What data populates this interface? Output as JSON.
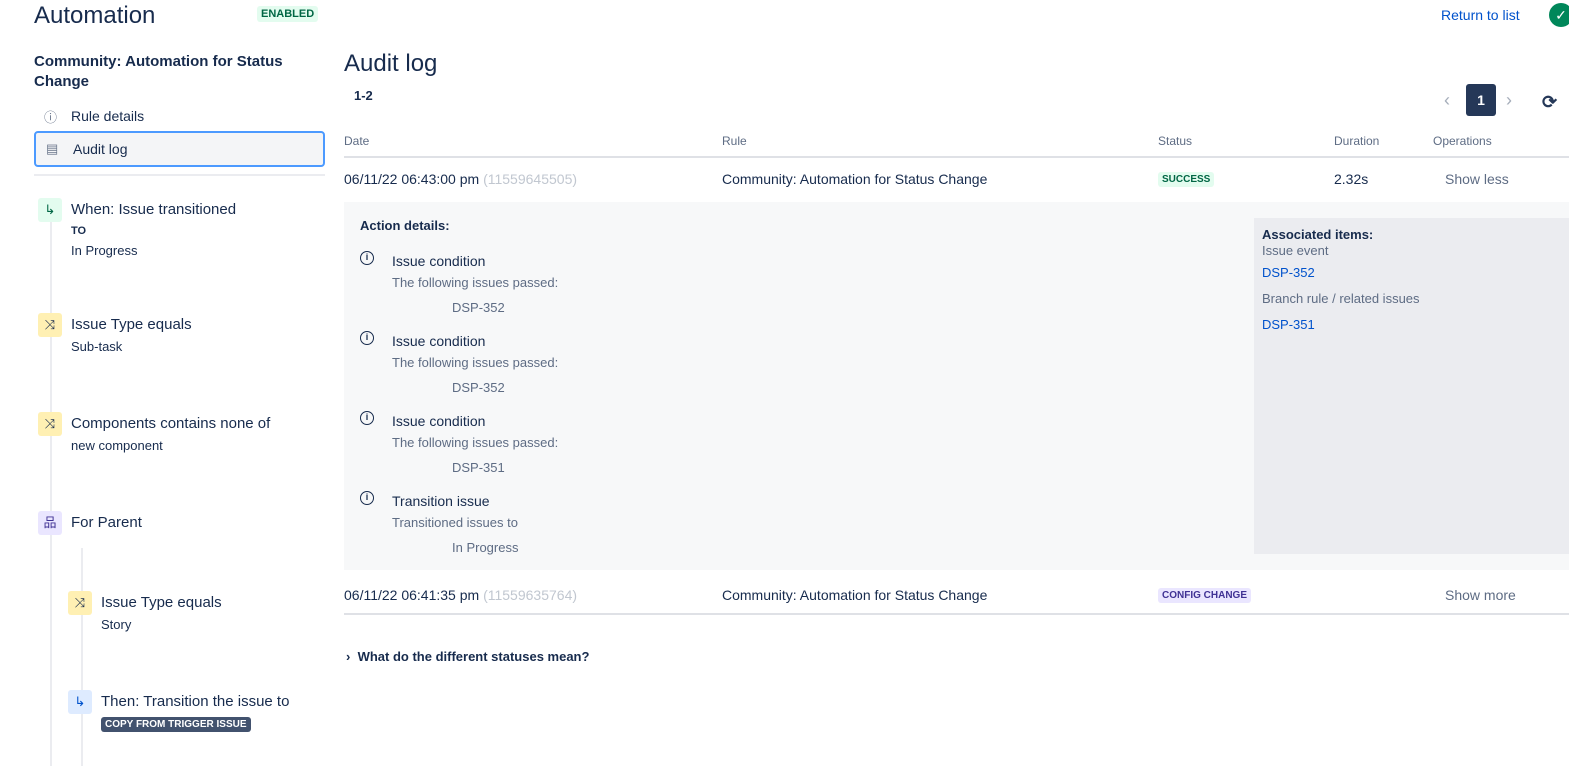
{
  "header": {
    "title": "Automation",
    "status": "ENABLED",
    "return_link": "Return to list"
  },
  "sidebar": {
    "rule_name": "Community: Automation for Status Change",
    "nav": [
      {
        "label": "Rule details",
        "icon": "info-icon"
      },
      {
        "label": "Audit log",
        "icon": "document-icon"
      }
    ],
    "steps": [
      {
        "title": "When: Issue transitioned",
        "sub1": "TO",
        "sub2": "In Progress",
        "icon": "transition-icon"
      },
      {
        "title": "Issue Type equals",
        "sub1": "Sub-task",
        "icon": "shuffle-icon"
      },
      {
        "title": "Components contains none of",
        "sub1": "new component",
        "icon": "shuffle-icon"
      },
      {
        "title": "For Parent",
        "icon": "hierarchy-icon"
      },
      {
        "title": "Issue Type equals",
        "sub1": "Story",
        "icon": "shuffle-icon"
      },
      {
        "title": "Then: Transition the issue to",
        "badge": "COPY FROM TRIGGER ISSUE",
        "icon": "transition-icon"
      }
    ]
  },
  "main": {
    "title": "Audit log",
    "range": "1-2",
    "page": "1",
    "columns": [
      "Date",
      "Rule",
      "Status",
      "Duration",
      "Operations"
    ],
    "rows": [
      {
        "date": "06/11/22 06:43:00 pm",
        "id": "(11559645505)",
        "rule": "Community: Automation for Status Change",
        "status": "SUCCESS",
        "duration": "2.32s",
        "op": "Show less"
      },
      {
        "date": "06/11/22 06:41:35 pm",
        "id": "(11559635764)",
        "rule": "Community: Automation for Status Change",
        "status": "CONFIG CHANGE",
        "duration": "",
        "op": "Show more"
      }
    ],
    "details": {
      "heading": "Action details:",
      "actions": [
        {
          "title": "Issue condition",
          "desc": "The following issues passed:",
          "value": "DSP-352"
        },
        {
          "title": "Issue condition",
          "desc": "The following issues passed:",
          "value": "DSP-352"
        },
        {
          "title": "Issue condition",
          "desc": "The following issues passed:",
          "value": "DSP-351"
        },
        {
          "title": "Transition issue",
          "desc": "Transitioned issues to",
          "value": "In Progress"
        }
      ],
      "assoc": {
        "heading": "Associated items:",
        "event_label": "Issue event",
        "event_link": "DSP-352",
        "branch_label": "Branch rule / related issues",
        "branch_link": "DSP-351"
      }
    },
    "faq": "What do the different statuses mean?"
  }
}
